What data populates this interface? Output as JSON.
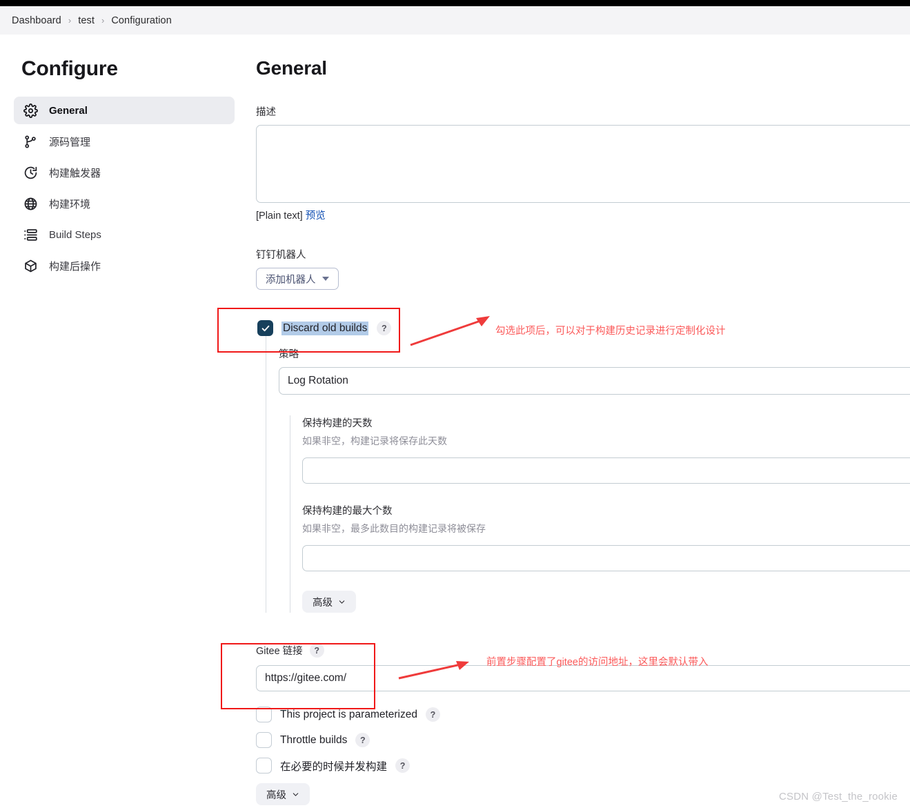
{
  "breadcrumb": {
    "items": [
      "Dashboard",
      "test",
      "Configuration"
    ],
    "separator": "›"
  },
  "sidebar": {
    "title": "Configure",
    "items": [
      {
        "label": "General",
        "icon": "gear-icon",
        "active": true
      },
      {
        "label": "源码管理",
        "icon": "branch-icon",
        "active": false
      },
      {
        "label": "构建触发器",
        "icon": "clock-icon",
        "active": false
      },
      {
        "label": "构建环境",
        "icon": "globe-icon",
        "active": false
      },
      {
        "label": "Build Steps",
        "icon": "list-icon",
        "active": false
      },
      {
        "label": "构建后操作",
        "icon": "box-icon",
        "active": false
      }
    ]
  },
  "main": {
    "title": "General",
    "description": {
      "label": "描述",
      "value": "",
      "plain_text_note": "[Plain text]",
      "preview_link": "预览"
    },
    "dingtalk": {
      "label": "钉钉机器人",
      "button_label": "添加机器人"
    },
    "discard_old_builds": {
      "label": "Discard old builds",
      "checked": true,
      "help": "?",
      "strategy_label": "策略",
      "strategy_value": "Log Rotation",
      "days_to_keep": {
        "label": "保持构建的天数",
        "hint": "如果非空，构建记录将保存此天数",
        "value": ""
      },
      "max_builds_to_keep": {
        "label": "保持构建的最大个数",
        "hint": "如果非空，最多此数目的构建记录将被保存",
        "value": ""
      },
      "advanced_button": "高级"
    },
    "gitee": {
      "label": "Gitee 链接",
      "help": "?",
      "value": "https://gitee.com/"
    },
    "checkboxes": [
      {
        "label": "This project is parameterized",
        "checked": false,
        "help": "?"
      },
      {
        "label": "Throttle builds",
        "checked": false,
        "help": "?"
      },
      {
        "label": "在必要的时候并发构建",
        "checked": false,
        "help": "?"
      }
    ],
    "bottom_advanced_button": "高级"
  },
  "annotations": [
    {
      "name": "discard-old-builds-note",
      "text": "勾选此项后，可以对于构建历史记录进行定制化设计"
    },
    {
      "name": "gitee-link-note",
      "text": "前置步骤配置了gitee的访问地址，这里会默认带入"
    }
  ],
  "watermark": "CSDN @Test_the_rookie",
  "colors": {
    "annotation_red": "#f01818",
    "annotation_text_red": "#fb5a5a",
    "checkbox_checked": "#17405c",
    "selection_highlight": "#b2cbe8",
    "link_blue": "#1351b4"
  }
}
